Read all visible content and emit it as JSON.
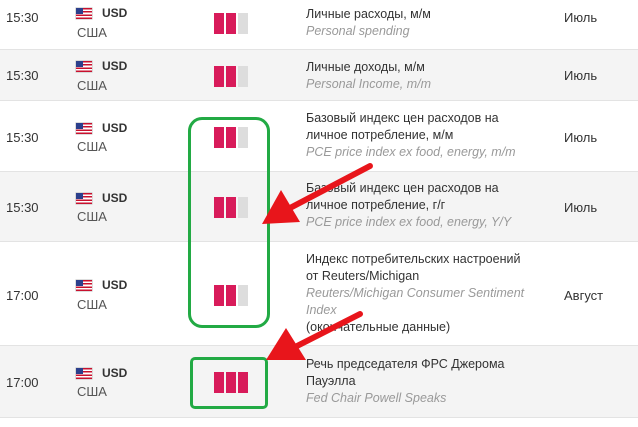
{
  "events": [
    {
      "time": "15:30",
      "currency": "USD",
      "country": "США",
      "impact": 2,
      "title": "Личные расходы, м/м",
      "title_en": "Personal spending",
      "period": "Июль"
    },
    {
      "time": "15:30",
      "currency": "USD",
      "country": "США",
      "impact": 2,
      "title": "Личные доходы, м/м",
      "title_en": "Personal Income, m/m",
      "period": "Июль"
    },
    {
      "time": "15:30",
      "currency": "USD",
      "country": "США",
      "impact": 2,
      "title": "Базовый индекс цен расходов на личное потребление, м/м",
      "title_en": "PCE price index ex food, energy, m/m",
      "period": "Июль"
    },
    {
      "time": "15:30",
      "currency": "USD",
      "country": "США",
      "impact": 2,
      "title": "Базовый индекс цен расходов на личное потребление, г/г",
      "title_en": "PCE price index ex food, energy, Y/Y",
      "period": "Июль"
    },
    {
      "time": "17:00",
      "currency": "USD",
      "country": "США",
      "impact": 2,
      "title": "Индекс потребительских настроений от Reuters/Michigan",
      "title_en": "Reuters/Michigan Consumer Sentiment Index",
      "title_note": "(окончательные данные)",
      "period": "Август"
    },
    {
      "time": "17:00",
      "currency": "USD",
      "country": "США",
      "impact": 3,
      "title": "Речь председателя ФРС Джерома Пауэлла",
      "title_en": "Fed Chair Powell Speaks",
      "period": ""
    }
  ],
  "colors": {
    "impact_on": "#d81b5a",
    "impact_off": "#dddddd",
    "highlight": "#22aa44",
    "arrow": "#e8151b",
    "row_alt": "#f4f4f4"
  },
  "icons": {
    "flag": "us-flag-icon",
    "arrow": "red-arrow-icon"
  }
}
